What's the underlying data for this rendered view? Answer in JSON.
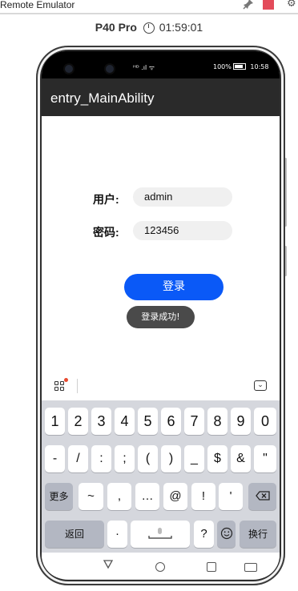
{
  "emulator": {
    "title": "Remote Emulator",
    "device_name": "P40 Pro",
    "timer": "01:59:01"
  },
  "status_bar": {
    "signal": "ᴴᴰ .ıl ᯤ",
    "battery": "100%",
    "time": "10:58"
  },
  "app": {
    "title": "entry_MainAbility"
  },
  "form": {
    "user_label": "用户:",
    "user_value": "admin",
    "password_label": "密码:",
    "password_value": "123456",
    "login_button": "登录",
    "toast": "登录成功!"
  },
  "keyboard": {
    "row1": [
      "1",
      "2",
      "3",
      "4",
      "5",
      "6",
      "7",
      "8",
      "9",
      "0"
    ],
    "row2": [
      "-",
      "/",
      ":",
      ";",
      "(",
      ")",
      "_",
      "$",
      "&",
      "\""
    ],
    "row3": [
      "更多",
      "~",
      ",",
      "…",
      "@",
      "!",
      "'"
    ],
    "row4": {
      "return": "返回",
      "dot": "·",
      "question": "?",
      "enter": "换行"
    }
  },
  "icons": {
    "pin": "pin-icon",
    "close": "close-icon",
    "timer": "timer-icon",
    "delete": "backspace-icon",
    "emoji": "emoji-icon",
    "microphone": "microphone-icon"
  },
  "colors": {
    "primary_button": "#0a59f7",
    "toast_bg": "#4a4a4a",
    "title_bar": "#2a2a2a",
    "keyboard_bg": "#d5d7dd"
  }
}
